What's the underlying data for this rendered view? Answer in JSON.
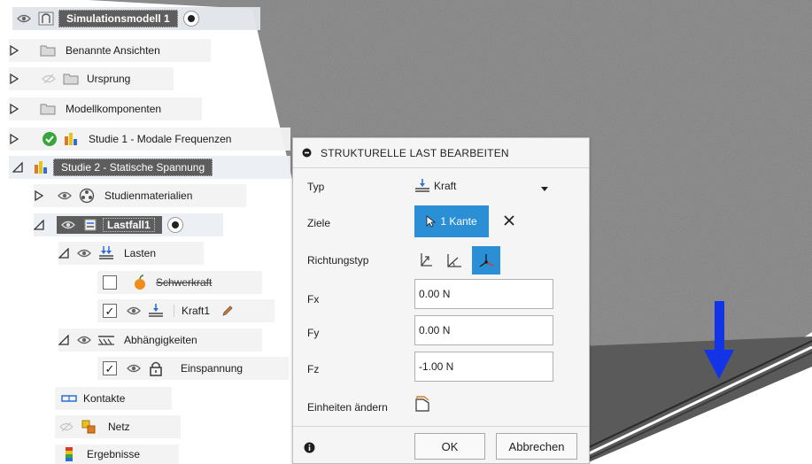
{
  "browser": {
    "root": {
      "label": "Simulationsmodell 1"
    },
    "items": [
      {
        "label": "Benannte Ansichten"
      },
      {
        "label": "Ursprung"
      },
      {
        "label": "Modellkomponenten"
      },
      {
        "label": "Studie 1 - Modale Frequenzen"
      },
      {
        "label": "Studie 2 - Statische Spannung"
      },
      {
        "label": "Studienmaterialien"
      },
      {
        "label": "Lastfall1"
      },
      {
        "label": "Lasten"
      },
      {
        "label": "Schwerkraft"
      },
      {
        "label": "Kraft1"
      },
      {
        "label": "Abhängigkeiten"
      },
      {
        "label": "Einspannung"
      },
      {
        "label": "Kontakte"
      },
      {
        "label": "Netz"
      },
      {
        "label": "Ergebnisse"
      }
    ]
  },
  "dialog": {
    "title": "STRUKTURELLE LAST BEARBEITEN",
    "type_label": "Typ",
    "type_value": "Kraft",
    "targets_label": "Ziele",
    "targets_value": "1 Kante",
    "direction_label": "Richtungstyp",
    "fx_label": "Fx",
    "fx_value": "0.00 N",
    "fy_label": "Fy",
    "fy_value": "0.00 N",
    "fz_label": "Fz",
    "fz_value": "-1.00 N",
    "units_label": "Einheiten ändern",
    "ok_label": "OK",
    "cancel_label": "Abbrechen"
  },
  "colors": {
    "accent": "#2b8fd6",
    "force_arrow": "#1234e6",
    "study_ok": "#3aa53a"
  }
}
